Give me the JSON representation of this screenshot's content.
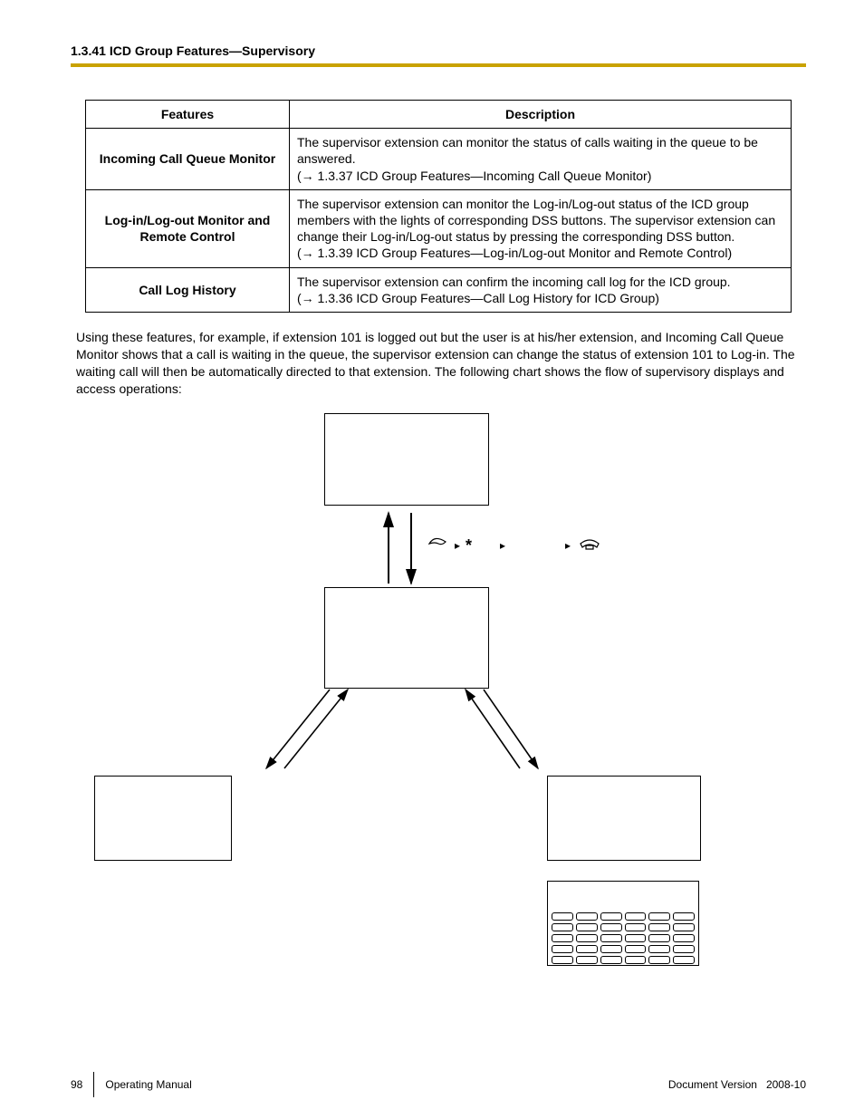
{
  "header": {
    "title": "1.3.41 ICD Group Features—Supervisory"
  },
  "table": {
    "columns": {
      "features": "Features",
      "description": "Description"
    },
    "rows": [
      {
        "feature": "Incoming Call Queue Monitor",
        "desc_main": "The supervisor extension can monitor the status of calls waiting in the queue to be answered.",
        "ref": "(→ 1.3.37  ICD Group Features—Incoming Call Queue Monitor)"
      },
      {
        "feature": "Log-in/Log-out Monitor and Remote Control",
        "desc_main": "The supervisor extension can monitor the Log-in/Log-out status of the ICD group members with the lights of corresponding DSS buttons. The supervisor extension can change their Log-in/Log-out status by pressing the corresponding DSS button.",
        "ref": "(→ 1.3.39  ICD Group Features—Log-in/Log-out Monitor and Remote Control)"
      },
      {
        "feature": "Call Log History",
        "desc_main": "The supervisor extension can confirm the incoming call log for the ICD group.",
        "ref": "(→ 1.3.36  ICD Group Features—Call Log History for ICD Group)"
      }
    ]
  },
  "paragraph": "Using these features, for example, if extension 101 is logged out but the user is at his/her extension, and Incoming Call Queue Monitor shows that a call is waiting in the queue, the supervisor extension can change the status of extension 101 to Log-in. The waiting call will then be automatically directed to that extension. The following chart shows the flow of supervisory displays and access operations:",
  "diagram": {
    "sequence_key": "*",
    "icons": {
      "offhook": "off-hook-icon",
      "onhook": "on-hook-icon",
      "play": "▸"
    }
  },
  "footer": {
    "page_number": "98",
    "manual": "Operating Manual",
    "doc_version_label": "Document Version",
    "doc_version_value": "2008-10"
  }
}
